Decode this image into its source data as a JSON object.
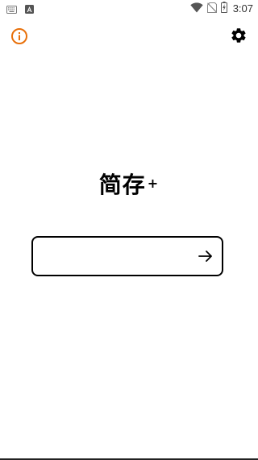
{
  "status_bar": {
    "time": "3:07",
    "icons": [
      "keyboard-icon",
      "app-notification-icon",
      "wifi-icon",
      "no-sim-icon",
      "battery-charging-icon"
    ]
  },
  "header": {
    "left_icon": "info-icon",
    "right_icon": "gear-icon"
  },
  "logo": {
    "main": "简存",
    "sup": "+"
  },
  "input": {
    "value": "",
    "placeholder": "",
    "submit_icon": "arrow-right-icon"
  },
  "colors": {
    "accent": "#E8700A",
    "text": "#000000",
    "background": "#FFFFFF"
  }
}
